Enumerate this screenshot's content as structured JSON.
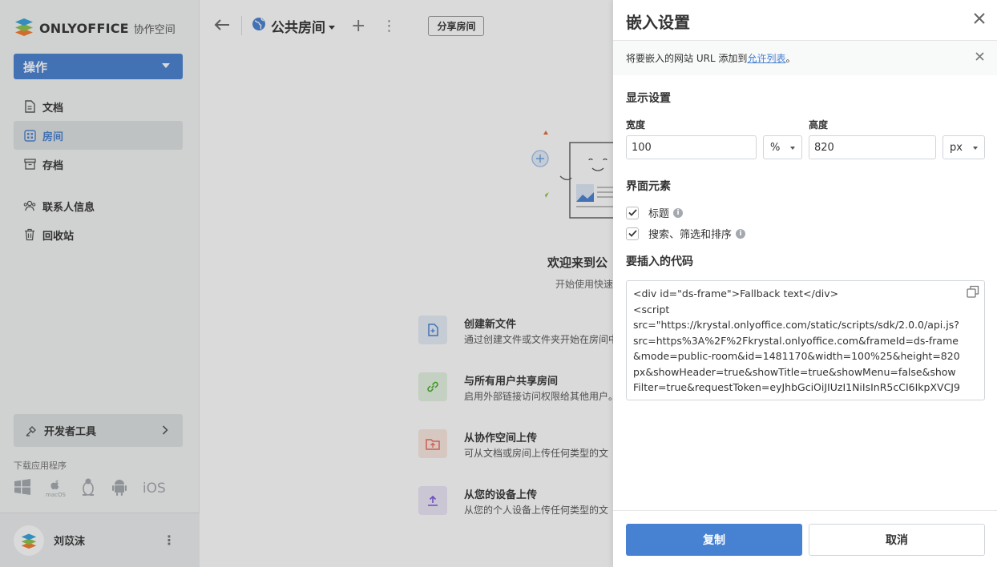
{
  "sidebar": {
    "logo": {
      "brand": "ONLYOFFICE",
      "product": "协作空间"
    },
    "action_button": {
      "label": "操作"
    },
    "nav": [
      {
        "label": "文档",
        "icon": "document-icon"
      },
      {
        "label": "房间",
        "icon": "rooms-icon",
        "active": true
      },
      {
        "label": "存档",
        "icon": "archive-icon"
      },
      {
        "label": "联系人信息",
        "icon": "contacts-icon"
      },
      {
        "label": "回收站",
        "icon": "trash-icon"
      }
    ],
    "developer_tools": {
      "label": "开发者工具"
    },
    "download_label": "下载应用程序",
    "apps": {
      "macos": "macOS",
      "ios": "iOS"
    },
    "user": {
      "name": "刘苡沫"
    }
  },
  "header": {
    "title": "公共房间",
    "share_button": "分享房间"
  },
  "empty_state": {
    "title": "欢迎来到公",
    "subtitle": "开始使用快速",
    "options": [
      {
        "title": "创建新文件",
        "desc": "通过创建文件或文件夹开始在房间中",
        "color": "#4781d1"
      },
      {
        "title": "与所有用户共享房间",
        "desc": "启用外部链接访问权限给其他用户。",
        "color": "#35ad17"
      },
      {
        "title": "从协作空间上传",
        "desc": "可从文档或房间上传任何类型的文",
        "color": "#f2675a"
      },
      {
        "title": "从您的设备上传",
        "desc": "从您的个人设备上传任何类型的文",
        "color": "#7757d9"
      }
    ]
  },
  "panel": {
    "title": "嵌入设置",
    "notice": {
      "text_before": "将要嵌入的网站 URL 添加到",
      "link": "允许列表",
      "text_after": "。"
    },
    "display_section": "显示设置",
    "width": {
      "label": "宽度",
      "value": "100",
      "unit": "%"
    },
    "height": {
      "label": "高度",
      "value": "820",
      "unit": "px"
    },
    "interface_section": "界面元素",
    "checkboxes": [
      {
        "label": "标题",
        "checked": true
      },
      {
        "label": "搜索、筛选和排序",
        "checked": true
      }
    ],
    "code_section": "要插入的代码",
    "code": "<div id=\"ds-frame\">Fallback text</div>\n<script\nsrc=\"https://krystal.onlyoffice.com/static/scripts/sdk/2.0.0/api.js?src=https%3A%2F%2Fkrystal.onlyoffice.com&frameId=ds-frame&mode=public-room&id=1481170&width=100%25&height=820px&showHeader=true&showTitle=true&showMenu=false&showFilter=true&requestToken=eyJhbGciOiJIUzI1NiIsInR5cCI6IkpXVCJ9",
    "copy_button": "复制",
    "cancel_button": "取消"
  }
}
